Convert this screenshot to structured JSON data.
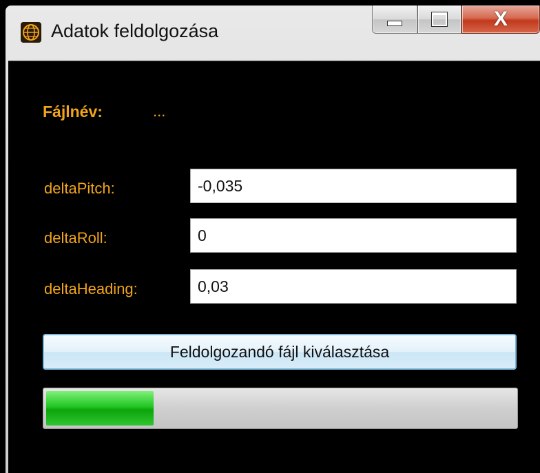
{
  "window": {
    "title": "Adatok feldolgozása",
    "icon": "globe-icon",
    "controls": {
      "minimize_icon": "minimize-icon",
      "maximize_icon": "maximize-icon",
      "close_icon": "close-icon",
      "close_glyph": "X"
    }
  },
  "file": {
    "label": "Fájlnév:",
    "value": "..."
  },
  "fields": [
    {
      "label": "deltaPitch:",
      "value": "-0,035"
    },
    {
      "label": "deltaRoll:",
      "value": "0"
    },
    {
      "label": "deltaHeading:",
      "value": "0,03"
    }
  ],
  "select_button": {
    "label": "Feldolgozandó fájl kiválasztása"
  },
  "progress": {
    "fraction": 0.23
  },
  "colors": {
    "label": "#f2a51b",
    "background": "#000000",
    "progress_fill": "#22c622"
  }
}
